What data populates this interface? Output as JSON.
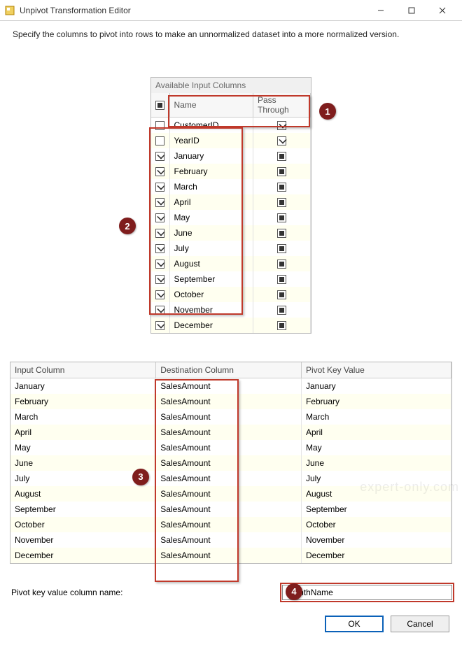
{
  "window": {
    "title": "Unpivot Transformation Editor",
    "description": "Specify the columns to pivot into rows to make an unnormalized dataset into a more normalized version."
  },
  "available": {
    "panel_title": "Available Input Columns",
    "headers": {
      "name": "Name",
      "pass": "Pass Through"
    },
    "rows": [
      {
        "name": "CustomerID",
        "checked": false,
        "pass": "check"
      },
      {
        "name": "YearID",
        "checked": false,
        "pass": "check"
      },
      {
        "name": "January",
        "checked": true,
        "pass": "square"
      },
      {
        "name": "February",
        "checked": true,
        "pass": "square"
      },
      {
        "name": "March",
        "checked": true,
        "pass": "square"
      },
      {
        "name": "April",
        "checked": true,
        "pass": "square"
      },
      {
        "name": "May",
        "checked": true,
        "pass": "square"
      },
      {
        "name": "June",
        "checked": true,
        "pass": "square"
      },
      {
        "name": "July",
        "checked": true,
        "pass": "square"
      },
      {
        "name": "August",
        "checked": true,
        "pass": "square"
      },
      {
        "name": "September",
        "checked": true,
        "pass": "square"
      },
      {
        "name": "October",
        "checked": true,
        "pass": "square"
      },
      {
        "name": "November",
        "checked": true,
        "pass": "square"
      },
      {
        "name": "December",
        "checked": true,
        "pass": "square"
      }
    ]
  },
  "mapping": {
    "headers": {
      "input": "Input Column",
      "dest": "Destination Column",
      "pkv": "Pivot Key Value"
    },
    "rows": [
      {
        "input": "January",
        "dest": "SalesAmount",
        "pkv": "January"
      },
      {
        "input": "February",
        "dest": "SalesAmount",
        "pkv": "February"
      },
      {
        "input": "March",
        "dest": "SalesAmount",
        "pkv": "March"
      },
      {
        "input": "April",
        "dest": "SalesAmount",
        "pkv": "April"
      },
      {
        "input": "May",
        "dest": "SalesAmount",
        "pkv": "May"
      },
      {
        "input": "June",
        "dest": "SalesAmount",
        "pkv": "June"
      },
      {
        "input": "July",
        "dest": "SalesAmount",
        "pkv": "July"
      },
      {
        "input": "August",
        "dest": "SalesAmount",
        "pkv": "August"
      },
      {
        "input": "September",
        "dest": "SalesAmount",
        "pkv": "September"
      },
      {
        "input": "October",
        "dest": "SalesAmount",
        "pkv": "October"
      },
      {
        "input": "November",
        "dest": "SalesAmount",
        "pkv": "November"
      },
      {
        "input": "December",
        "dest": "SalesAmount",
        "pkv": "December"
      }
    ]
  },
  "pivot_key": {
    "label": "Pivot key value column name:",
    "value": "MonthName"
  },
  "buttons": {
    "ok": "OK",
    "cancel": "Cancel"
  },
  "callouts": {
    "c1": "1",
    "c2": "2",
    "c3": "3",
    "c4": "4"
  }
}
